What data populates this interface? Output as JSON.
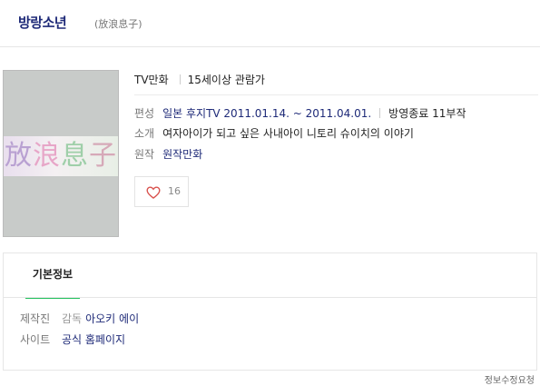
{
  "header": {
    "title": "방랑소년",
    "original_title": "(放浪息子)"
  },
  "poster": {
    "logo_text": "放浪息子"
  },
  "meta": {
    "category": "TV만화",
    "rating": "15세이상 관람가"
  },
  "details": {
    "broadcast_label": "편성",
    "broadcast_value": "일본 후지TV 2011.01.14. ~ 2011.04.01.",
    "ended_value": "방영종료 11부작",
    "intro_label": "소개",
    "intro_value": "여자아이가 되고 싶은 사내아이 니토리 슈이치의 이야기",
    "original_label": "원작",
    "original_value": "원작만화"
  },
  "like": {
    "count": "16"
  },
  "basic_info": {
    "tab_label": "기본정보",
    "production_label": "제작진",
    "director_label": "감독",
    "director_value": "아오키 에이",
    "site_label": "사이트",
    "site_value": "공식 홈페이지"
  },
  "footer": {
    "corner_text": "정보수정요청"
  },
  "colors": {
    "accent": "#1e2a78",
    "tab_underline": "#22c15e",
    "heart": "#d9534f"
  }
}
